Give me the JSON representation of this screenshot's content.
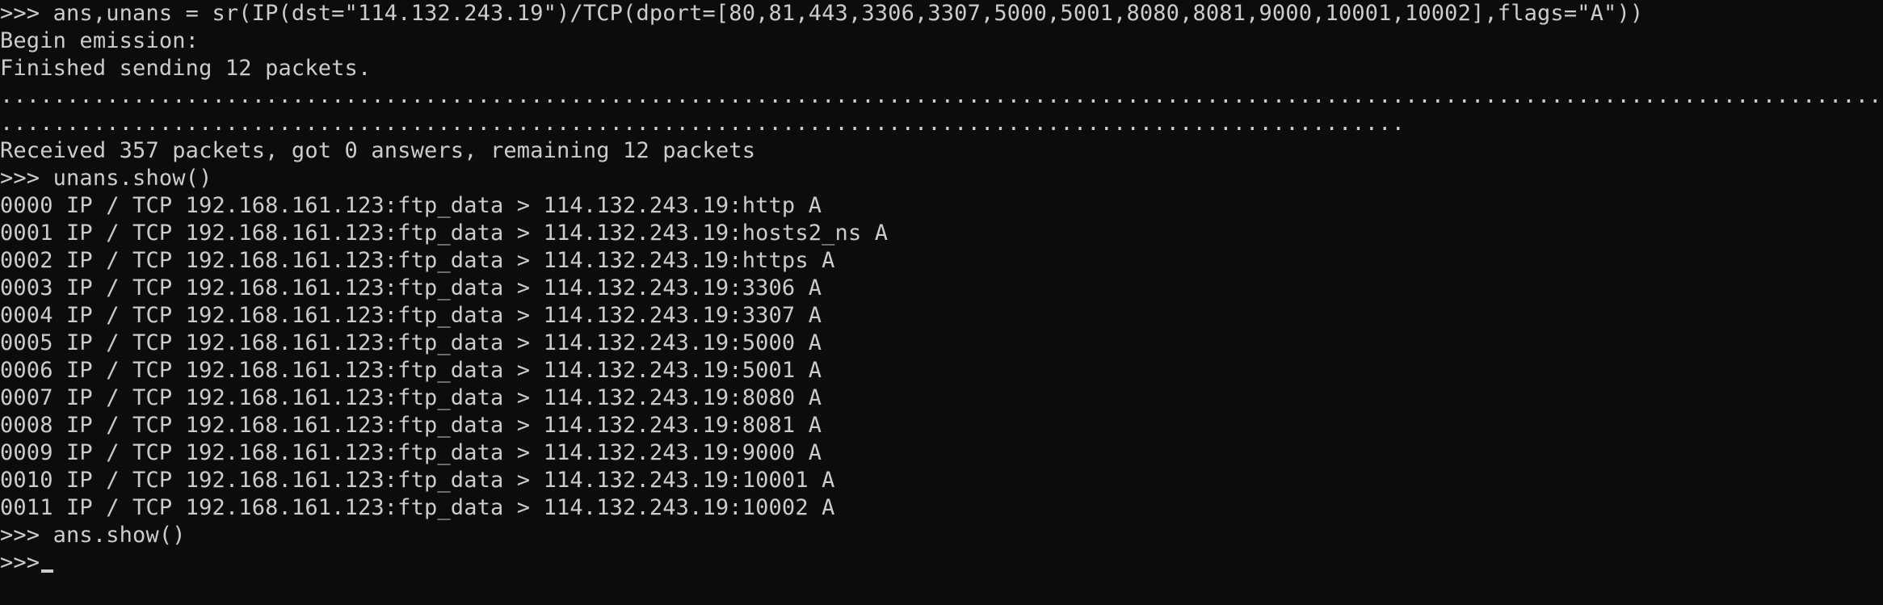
{
  "console": {
    "lines": [
      ">>> ans,unans = sr(IP(dst=\"114.132.243.19\")/TCP(dport=[80,81,443,3306,3307,5000,5001,8080,8081,9000,10001,10002],flags=\"A\"))",
      "Begin emission:",
      "Finished sending 12 packets.",
      "...............................................................................................................................................................................................",
      "..........................................................................................................",
      "Received 357 packets, got 0 answers, remaining 12 packets",
      ">>> unans.show()",
      "0000 IP / TCP 192.168.161.123:ftp_data > 114.132.243.19:http A",
      "0001 IP / TCP 192.168.161.123:ftp_data > 114.132.243.19:hosts2_ns A",
      "0002 IP / TCP 192.168.161.123:ftp_data > 114.132.243.19:https A",
      "0003 IP / TCP 192.168.161.123:ftp_data > 114.132.243.19:3306 A",
      "0004 IP / TCP 192.168.161.123:ftp_data > 114.132.243.19:3307 A",
      "0005 IP / TCP 192.168.161.123:ftp_data > 114.132.243.19:5000 A",
      "0006 IP / TCP 192.168.161.123:ftp_data > 114.132.243.19:5001 A",
      "0007 IP / TCP 192.168.161.123:ftp_data > 114.132.243.19:8080 A",
      "0008 IP / TCP 192.168.161.123:ftp_data > 114.132.243.19:8081 A",
      "0009 IP / TCP 192.168.161.123:ftp_data > 114.132.243.19:9000 A",
      "0010 IP / TCP 192.168.161.123:ftp_data > 114.132.243.19:10001 A",
      "0011 IP / TCP 192.168.161.123:ftp_data > 114.132.243.19:10002 A",
      ">>> ans.show()"
    ],
    "prompt": ">>>"
  },
  "colors": {
    "background": "#0c0c0c",
    "foreground": "#cccccc"
  }
}
